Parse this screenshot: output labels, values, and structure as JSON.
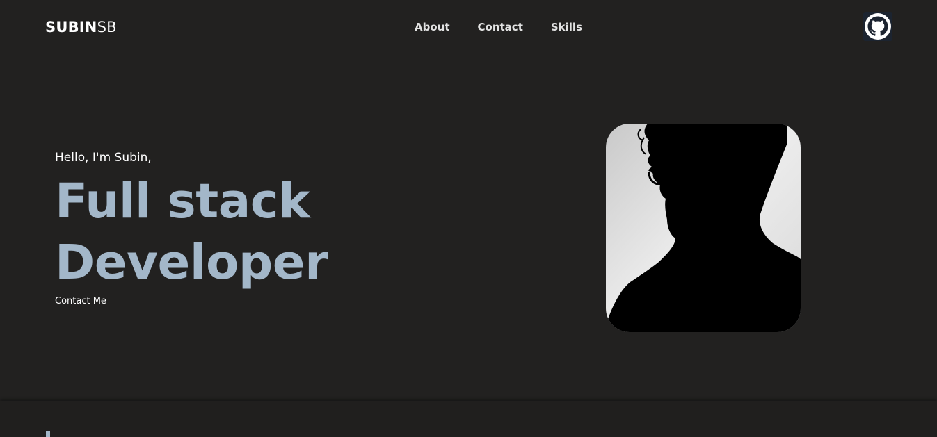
{
  "header": {
    "brand_bold": "SUBIN",
    "brand_light": "SB",
    "nav": [
      {
        "label": "About"
      },
      {
        "label": "Contact"
      },
      {
        "label": "Skills"
      }
    ],
    "github_icon": "github-icon"
  },
  "hero": {
    "greeting": "Hello, I'm Subin,",
    "title_line1": "Full stack",
    "title_line2": "Developer",
    "contact_label": "Contact Me",
    "image": "profile-silhouette-photo"
  },
  "colors": {
    "background": "#222120",
    "accent": "#a3b7c9",
    "text": "#ffffff"
  }
}
